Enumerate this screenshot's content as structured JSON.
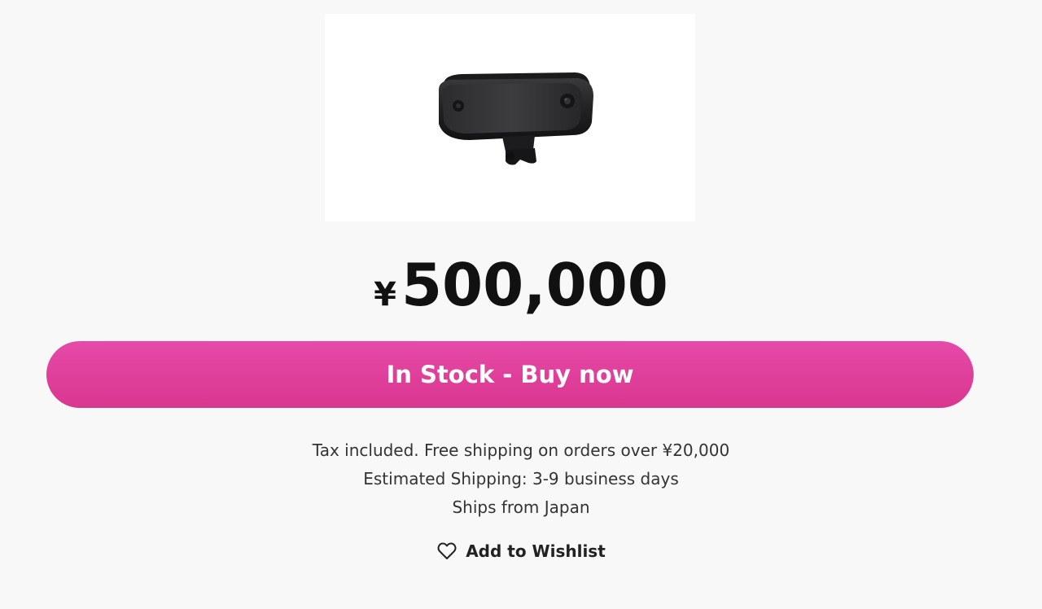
{
  "product": {
    "image_alt": "Black stereo camera device with mount",
    "price_currency": "¥",
    "price_amount": "500,000"
  },
  "buy_button": {
    "label": "In Stock - Buy now",
    "color_top": "#e64aa8",
    "color_bottom": "#d9368f"
  },
  "info": {
    "tax_line": "Tax included. Free shipping on orders over ¥20,000",
    "shipping_estimate": "Estimated Shipping: 3-9 business days",
    "ships_from": "Ships from Japan"
  },
  "wishlist": {
    "label": "Add to Wishlist",
    "icon": "heart-outline-icon"
  }
}
